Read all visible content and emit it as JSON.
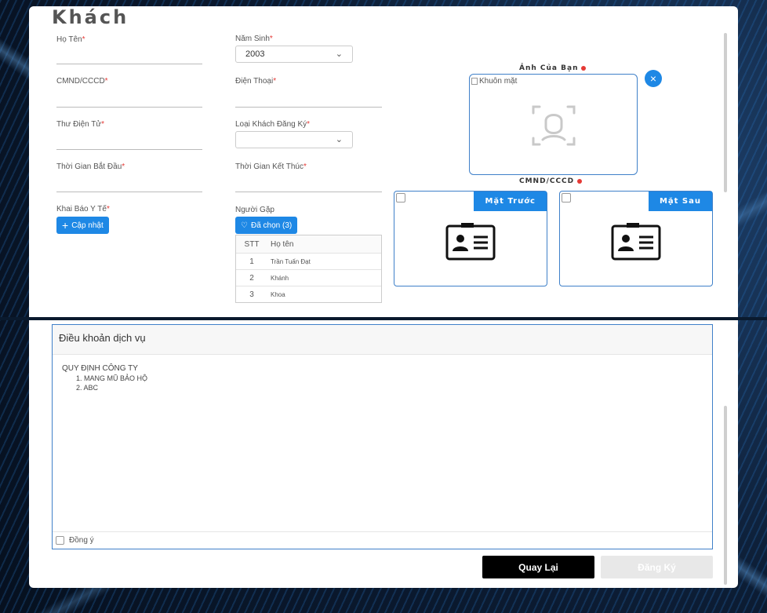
{
  "page": {
    "title": "Khách"
  },
  "form": {
    "ho_ten": {
      "label": "Họ Tên",
      "value": ""
    },
    "nam_sinh": {
      "label": "Năm Sinh",
      "value": "2003"
    },
    "cmnd": {
      "label": "CMND/CCCD",
      "value": ""
    },
    "dien_thoai": {
      "label": "Điện Thoại",
      "value": ""
    },
    "thu_dien_tu": {
      "label": "Thư Điện Tử",
      "value": ""
    },
    "loai_khach": {
      "label": "Loại Khách Đăng Ký",
      "value": ""
    },
    "bat_dau": {
      "label": "Thời Gian Bắt Đầu",
      "value": ""
    },
    "ket_thuc": {
      "label": "Thời Gian Kết Thúc",
      "value": ""
    },
    "khai_bao": {
      "label": "Khai Báo Y Tế",
      "button": "Cập nhật"
    },
    "nguoi_gap": {
      "label": "Người Gặp",
      "button": "Đã chọn (3)"
    },
    "required_mark": "*"
  },
  "people_table": {
    "headers": [
      "STT",
      "Họ tên"
    ],
    "rows": [
      {
        "stt": "1",
        "name": "Trần Tuấn Đạt"
      },
      {
        "stt": "2",
        "name": "Khánh"
      },
      {
        "stt": "3",
        "name": "Khoa"
      }
    ]
  },
  "photo": {
    "label": "Ảnh Của Bạn",
    "alt": "Khuôn mặt"
  },
  "id_card": {
    "label": "CMND/CCCD",
    "front": "Mặt Trước",
    "back": "Mặt Sau"
  },
  "terms": {
    "title": "Điều khoản dịch vụ",
    "heading": "QUY ĐỊNH CÔNG TY",
    "items": [
      "1. MANG MŨ BẢO HỘ",
      "2. ABC"
    ],
    "agree": "Đồng ý"
  },
  "actions": {
    "back": "Quay Lại",
    "register": "Đăng Ký"
  },
  "colors": {
    "accent": "#1e88e5",
    "required": "#e53935"
  }
}
